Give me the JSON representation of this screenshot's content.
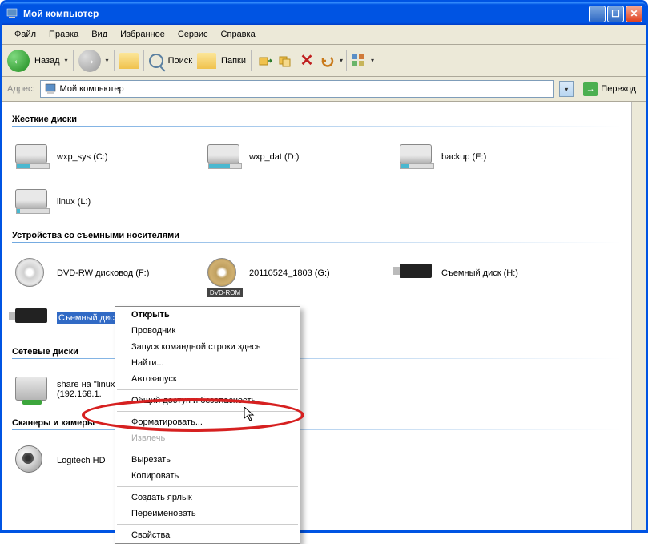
{
  "titlebar": {
    "title": "Мой компьютер"
  },
  "menubar": {
    "file": "Файл",
    "edit": "Правка",
    "view": "Вид",
    "favorites": "Избранное",
    "tools": "Сервис",
    "help": "Справка"
  },
  "toolbar": {
    "back": "Назад",
    "search": "Поиск",
    "folders": "Папки"
  },
  "addressbar": {
    "label": "Адрес:",
    "value": "Мой компьютер",
    "go": "Переход"
  },
  "sections": {
    "hard_drives": "Жесткие диски",
    "removable": "Устройства со съемными носителями",
    "network": "Сетевые диски",
    "scanners": "Сканеры и камеры"
  },
  "drives": {
    "hdd": [
      {
        "label": "wxp_sys (C:)"
      },
      {
        "label": "wxp_dat (D:)"
      },
      {
        "label": "backup (E:)"
      },
      {
        "label": "linux (L:)"
      }
    ],
    "removable": [
      {
        "label": "DVD-RW дисковод (F:)",
        "type": "dvd"
      },
      {
        "label": "20110524_1803 (G:)",
        "type": "dvdrom",
        "sublabel": "DVD-ROM"
      },
      {
        "label": "Съемный диск (H:)",
        "type": "usb"
      },
      {
        "label": "Съемный диск (I:)",
        "type": "usb",
        "selected": true
      }
    ],
    "network": [
      {
        "label_line1": "share на \"linux",
        "label_line2": "(192.168.1."
      }
    ],
    "scanners": [
      {
        "label": "Logitech HD"
      }
    ]
  },
  "context_menu": {
    "open": "Открыть",
    "explorer": "Проводник",
    "cmd": "Запуск командной строки здесь",
    "find": "Найти...",
    "autoplay": "Автозапуск",
    "sharing": "Общий доступ и безопасность...",
    "format": "Форматировать...",
    "eject": "Извлечь",
    "cut": "Вырезать",
    "copy": "Копировать",
    "shortcut": "Создать ярлык",
    "rename": "Переименовать",
    "properties": "Свойства"
  }
}
